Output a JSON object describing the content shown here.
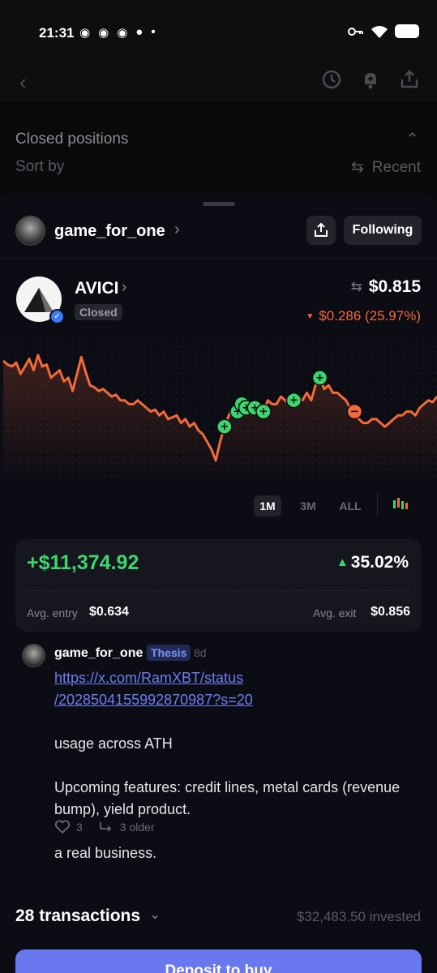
{
  "status_bar": {
    "time": "21:31",
    "notification_icons": [
      "discord-icon",
      "discord-icon",
      "discord-icon",
      "app-icon"
    ],
    "dot": "•"
  },
  "background": {
    "closed_positions_title": "Closed positions",
    "sort_by_label": "Sort by",
    "sort_value": "Recent"
  },
  "profile": {
    "username": "game_for_one",
    "follow_label": "Following"
  },
  "token": {
    "name": "AVICI",
    "status": "Closed",
    "price": "$0.815",
    "change": "$0.286 (25.97%)",
    "change_direction": "down",
    "change_color": "#f26a3a"
  },
  "chart_data": {
    "type": "line",
    "line_color": "#f26a3a",
    "series": [
      {
        "values": [
          0.93,
          0.91,
          0.9,
          0.92,
          0.86,
          0.9,
          0.94,
          0.88,
          0.96,
          0.9,
          0.91,
          0.84,
          0.86,
          0.88,
          0.82,
          0.84,
          0.77,
          0.86,
          0.95,
          0.87,
          0.8,
          0.79,
          0.77,
          0.78,
          0.76,
          0.74,
          0.75,
          0.72,
          0.72,
          0.7,
          0.7,
          0.72,
          0.7,
          0.68,
          0.66,
          0.67,
          0.64,
          0.66,
          0.62,
          0.63,
          0.64,
          0.6,
          0.62,
          0.58,
          0.6,
          0.56,
          0.54,
          0.5,
          0.46,
          0.4,
          0.5,
          0.58,
          0.64,
          0.68,
          0.66,
          0.7,
          0.68,
          0.66,
          0.68,
          0.7,
          0.66,
          0.72,
          0.7,
          0.7,
          0.74,
          0.72,
          0.7,
          0.72,
          0.74,
          0.72,
          0.76,
          0.72,
          0.8,
          0.84,
          0.78,
          0.8,
          0.76,
          0.76,
          0.74,
          0.72,
          0.68,
          0.66,
          0.62,
          0.6,
          0.6,
          0.62,
          0.62,
          0.6,
          0.58,
          0.6,
          0.62,
          0.64,
          0.64,
          0.66,
          0.66,
          0.64,
          0.68,
          0.7,
          0.72,
          0.71,
          0.74
        ]
      }
    ],
    "markers": [
      {
        "type": "buy",
        "index": 51
      },
      {
        "type": "buy",
        "index": 54
      },
      {
        "type": "buy",
        "index": 55
      },
      {
        "type": "buy",
        "index": 56
      },
      {
        "type": "buy",
        "index": 58
      },
      {
        "type": "buy",
        "index": 60
      },
      {
        "type": "buy",
        "index": 67
      },
      {
        "type": "buy",
        "index": 73
      },
      {
        "type": "sell",
        "index": 81
      }
    ],
    "buy_color": "#3dd56d",
    "sell_color": "#f26a3a"
  },
  "timeframes": [
    {
      "label": "1M",
      "active": true
    },
    {
      "label": "3M",
      "active": false
    },
    {
      "label": "ALL",
      "active": false
    }
  ],
  "pnl": {
    "value": "+$11,374.92",
    "percent": "35.02%",
    "direction": "up",
    "avg_entry_label": "Avg. entry",
    "avg_entry": "$0.634",
    "avg_exit_label": "Avg. exit",
    "avg_exit": "$0.856"
  },
  "post": {
    "author": "game_for_one",
    "badge": "Thesis",
    "age": "8d",
    "link_line1": "https://x.com/RamXBT/status",
    "link_line2": "/2028504155992870987?s=20",
    "para1": "usage across ATH",
    "para2": "Upcoming features: credit lines, metal cards (revenue bump), yield product.",
    "para3": "a real business.",
    "likes": "3",
    "older": "3 older"
  },
  "transactions": {
    "count_label": "28 transactions",
    "invested_label": "$32,483.50 invested"
  },
  "deposit_button_label": "Deposit to buy"
}
